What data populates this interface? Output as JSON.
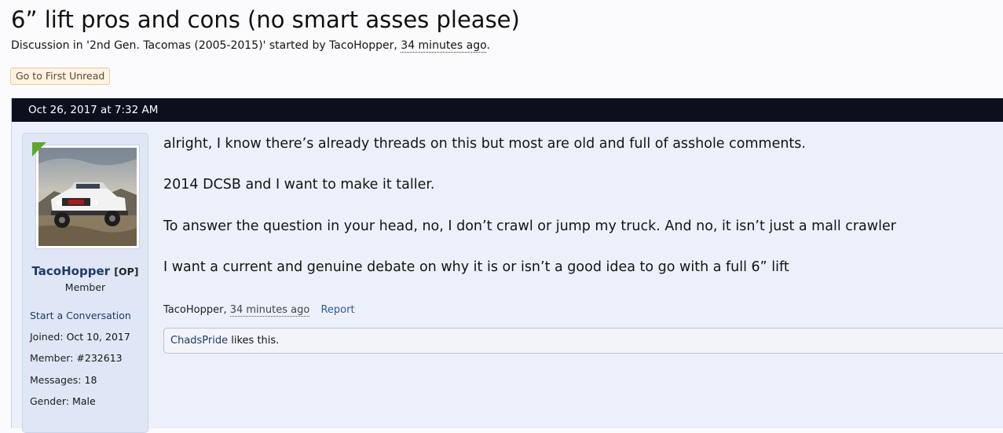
{
  "thread": {
    "title": "6” lift pros and cons (no smart asses please)",
    "meta_prefix": "Discussion in '2nd Gen. Tacomas (2005-2015)' started by TacoHopper,",
    "meta_time": "34 minutes ago",
    "meta_suffix": ".",
    "first_unread_label": "Go to First Unread"
  },
  "post": {
    "date": "Oct 26, 2017 at 7:32 AM",
    "author": {
      "username": "TacoHopper",
      "op_tag": "[OP]",
      "title": "Member",
      "start_conversation": "Start a Conversation",
      "joined_label": "Joined:",
      "joined": "Oct 10, 2017",
      "member_label": "Member:",
      "member_no": "#232613",
      "messages_label": "Messages:",
      "messages": "18",
      "gender_label": "Gender:",
      "gender": "Male"
    },
    "paragraphs": [
      "alright, I know there’s already threads on this but most are old and full of asshole comments.",
      "2014 DCSB and I want to make it taller.",
      "To answer the question in your head, no, I don’t crawl or jump my truck. And no, it isn’t just a mall crawler",
      "I want a current and genuine debate on why it is or isn’t a good idea to go with a full 6” lift"
    ],
    "footer_author": "TacoHopper",
    "footer_time": "34 minutes ago",
    "report_label": "Report",
    "likes_user": "ChadsPride",
    "likes_text": "likes this."
  },
  "colors": {
    "date_bar": "#0b0f1e",
    "username": "#1e3a66",
    "button_bg": "#fff3e1",
    "ribbon": "#5da72a"
  }
}
